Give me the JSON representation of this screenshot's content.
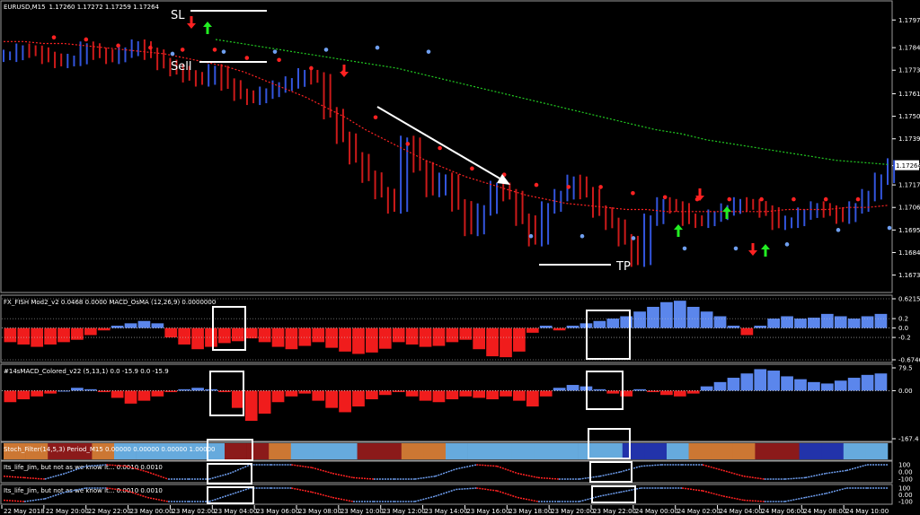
{
  "header": {
    "symbol": "EURUSD,M15",
    "quote": "1.17260 1.17272 1.17259 1.17264"
  },
  "annotations": {
    "sl": "SL",
    "sell": "Sell",
    "tp": "TP"
  },
  "colors": {
    "bull": "#3355dd",
    "bear": "#cc1a1a",
    "ma_red": "#ff2222",
    "ma_green": "#22cc22",
    "hist_pos": "#5b86ec",
    "hist_neg": "#f01c1c",
    "arrow_up": "#22ee22",
    "arrow_down": "#ff2222",
    "panel_border": "#9a9a9a"
  },
  "chart_data": [
    {
      "type": "line",
      "title": "EURUSD,M15",
      "price_axis": [
        "1.17975",
        "1.17840",
        "1.17730",
        "1.17615",
        "1.17505",
        "1.17395",
        "1.17264",
        "1.17170",
        "1.17060",
        "1.16950",
        "1.16840",
        "1.16730"
      ],
      "current_price": "1.17264",
      "ylim": [
        1.1668,
        1.1802
      ],
      "series": [
        {
          "values": [
            1.178,
            1.1783,
            1.1782,
            1.1779,
            1.1777,
            1.1778,
            1.1784,
            1.1781,
            1.1779,
            1.1782,
            1.1785,
            1.1781,
            1.1776,
            1.1773,
            1.177,
            1.1768,
            1.1773,
            1.1766,
            1.1761,
            1.1759,
            1.1762,
            1.1765,
            1.1767,
            1.1771,
            1.1769,
            1.1752,
            1.174,
            1.173,
            1.1721,
            1.1713,
            1.1706,
            1.1738,
            1.1726,
            1.1714,
            1.172,
            1.1707,
            1.1695,
            1.1705,
            1.1716,
            1.1712,
            1.17,
            1.169,
            1.1706,
            1.1712,
            1.1719,
            1.1713,
            1.1704,
            1.1698,
            1.169,
            1.168,
            1.17,
            1.1708,
            1.1706,
            1.17,
            1.1699,
            1.1702,
            1.1705,
            1.1708,
            1.1707,
            1.1704,
            1.1698,
            1.1699,
            1.1703,
            1.1706,
            1.1704,
            1.1701,
            1.1706,
            1.1712,
            1.172,
            1.1727
          ]
        },
        {
          "values": [
            1.1787,
            1.1787,
            1.1786,
            1.1786,
            1.1785,
            1.1784,
            1.1783,
            1.1782,
            1.1781,
            1.1779,
            1.1777,
            1.1775,
            1.1772,
            1.1768,
            1.1764,
            1.176,
            1.1755,
            1.175,
            1.1744,
            1.1739,
            1.1734,
            1.1729,
            1.1725,
            1.1721,
            1.1718,
            1.1715,
            1.1712,
            1.171,
            1.1708,
            1.1707,
            1.1706,
            1.1705,
            1.1705,
            1.1704,
            1.1704,
            1.1704,
            1.1704,
            1.1704,
            1.1704,
            1.1705,
            1.1705,
            1.1705,
            1.1706,
            1.1706,
            1.1707
          ]
        },
        {
          "values": [
            1.1788,
            1.1786,
            1.1784,
            1.1782,
            1.178,
            1.1778,
            1.1776,
            1.1774,
            1.1771,
            1.1768,
            1.1765,
            1.1762,
            1.1759,
            1.1756,
            1.1753,
            1.175,
            1.1747,
            1.1744,
            1.1742,
            1.1739,
            1.1737,
            1.1735,
            1.1733,
            1.1731,
            1.1729,
            1.1728,
            1.1727
          ]
        },
        {
          "values": [
            1.1789,
            1.1788,
            1.1785,
            1.1784,
            1.1783,
            1.1783,
            1.1779,
            1.1778,
            1.1774,
            1.1772,
            1.175,
            1.1737,
            1.1735,
            1.1725,
            1.1722,
            1.1717,
            1.1716,
            1.1716,
            1.1713,
            1.1711,
            1.171,
            1.171,
            1.171,
            1.171,
            1.171,
            1.171
          ]
        },
        {
          "values": [
            1.1781,
            1.1782,
            1.1782,
            1.1783,
            1.1784,
            1.1782,
            1.169,
            1.1692,
            1.1692,
            1.1691,
            1.1686,
            1.1686,
            1.1688,
            1.1695,
            1.1696
          ]
        }
      ]
    },
    {
      "type": "bar",
      "title": "FX_FISH Mod2_v2 0.0468 0.0000  MACD_OsMA (12,26,9) 0.0000000",
      "axis": [
        "0.6215",
        "0.2",
        "0.0",
        "-0.2",
        "-0.6746"
      ],
      "ylim": [
        -0.6746,
        0.6215
      ],
      "values": [
        -0.3,
        -0.35,
        -0.4,
        -0.35,
        -0.3,
        -0.25,
        -0.15,
        -0.05,
        0.05,
        0.1,
        0.15,
        0.1,
        -0.2,
        -0.35,
        -0.45,
        -0.4,
        -0.32,
        -0.28,
        -0.22,
        -0.3,
        -0.4,
        -0.45,
        -0.38,
        -0.3,
        -0.42,
        -0.5,
        -0.55,
        -0.52,
        -0.44,
        -0.3,
        -0.35,
        -0.4,
        -0.38,
        -0.3,
        -0.25,
        -0.45,
        -0.6,
        -0.62,
        -0.5,
        -0.1,
        0.05,
        -0.05,
        0.05,
        0.1,
        0.15,
        0.2,
        0.25,
        0.35,
        0.45,
        0.55,
        0.58,
        0.45,
        0.35,
        0.25,
        0.05,
        -0.15,
        0.05,
        0.2,
        0.25,
        0.2,
        0.22,
        0.3,
        0.25,
        0.2,
        0.25,
        0.3
      ]
    },
    {
      "type": "bar",
      "title": "#14sMACD_Colored_v22 (5,13,1) 0.0 -15.9 0.0 -15.9",
      "axis": [
        "79.5",
        "0.00",
        "-167.4"
      ],
      "ylim": [
        -167.4,
        79.5
      ],
      "values": [
        -40,
        -30,
        -20,
        -10,
        0,
        10,
        5,
        -5,
        -25,
        -45,
        -35,
        -20,
        -5,
        5,
        10,
        5,
        -5,
        -60,
        -105,
        -80,
        -40,
        -20,
        -10,
        -35,
        -60,
        -75,
        -55,
        -30,
        -15,
        -5,
        -20,
        -35,
        -40,
        -30,
        -20,
        -25,
        -30,
        -20,
        -35,
        -55,
        -20,
        10,
        20,
        15,
        5,
        -10,
        -20,
        5,
        -5,
        -15,
        -20,
        -10,
        15,
        30,
        45,
        60,
        75,
        70,
        50,
        40,
        30,
        25,
        35,
        45,
        55,
        60
      ]
    },
    {
      "type": "heatmap",
      "title": "Stoch_Filter(14,5,3) Period_M15 0.00000 0.00000 0.00000 1.00000",
      "colors": [
        "#cc7733",
        "#cc7733",
        "#8b1a1a",
        "#8b1a1a",
        "#cc7733",
        "#66aadd",
        "#66aadd",
        "#66aadd",
        "#66aadd",
        "#66aadd",
        "#8b1a1a",
        "#8b1a1a",
        "#cc7733",
        "#66aadd",
        "#66aadd",
        "#66aadd",
        "#8b1a1a",
        "#8b1a1a",
        "#cc7733",
        "#cc7733",
        "#66aadd",
        "#66aadd",
        "#66aadd",
        "#66aadd",
        "#66aadd",
        "#66aadd",
        "#66aadd",
        "#66aadd",
        "#2233aa",
        "#2233aa",
        "#66aadd",
        "#cc7733",
        "#cc7733",
        "#cc7733",
        "#8b1a1a",
        "#8b1a1a",
        "#2233aa",
        "#2233aa",
        "#66aadd",
        "#66aadd"
      ]
    },
    {
      "type": "line",
      "title": "Its_life_Jim, but not as we know it... 0.0010 0.0010",
      "axis": [
        "100",
        "0.00",
        "-100"
      ],
      "ylim": [
        -100,
        100
      ],
      "values": [
        -60,
        -80,
        -100,
        -20,
        80,
        100,
        80,
        0,
        -100,
        -100,
        -100,
        -20,
        100,
        100,
        100,
        60,
        -20,
        -80,
        -100,
        -100,
        -100,
        -60,
        40,
        100,
        80,
        -20,
        -80,
        -100,
        -100,
        -60,
        0,
        80,
        100,
        100,
        100,
        20,
        -60,
        -100,
        -100,
        -80,
        -20,
        20,
        100,
        100
      ]
    },
    {
      "type": "line",
      "title": "Its_life_Jim, but not as we know it... 0.0010 0.0010",
      "axis": [
        "100",
        "0.00",
        "-100"
      ],
      "ylim": [
        -100,
        100
      ],
      "values": [
        -80,
        -100,
        -60,
        40,
        100,
        100,
        60,
        -40,
        -100,
        -100,
        -100,
        0,
        100,
        100,
        100,
        40,
        -40,
        -100,
        -100,
        -100,
        -100,
        -20,
        80,
        100,
        60,
        -40,
        -100,
        -100,
        -100,
        -20,
        40,
        100,
        100,
        100,
        60,
        -20,
        -80,
        -100,
        -100,
        -40,
        20,
        100,
        100,
        100
      ]
    }
  ],
  "time_axis": [
    "22 May 2018",
    "22 May 20:00",
    "22 May 22:00",
    "23 May 00:00",
    "23 May 02:00",
    "23 May 04:00",
    "23 May 06:00",
    "23 May 08:00",
    "23 May 10:00",
    "23 May 12:00",
    "23 May 14:00",
    "23 May 16:00",
    "23 May 18:00",
    "23 May 20:00",
    "23 May 22:00",
    "24 May 00:00",
    "24 May 02:00",
    "24 May 04:00",
    "24 May 06:00",
    "24 May 08:00",
    "24 May 10:00"
  ]
}
